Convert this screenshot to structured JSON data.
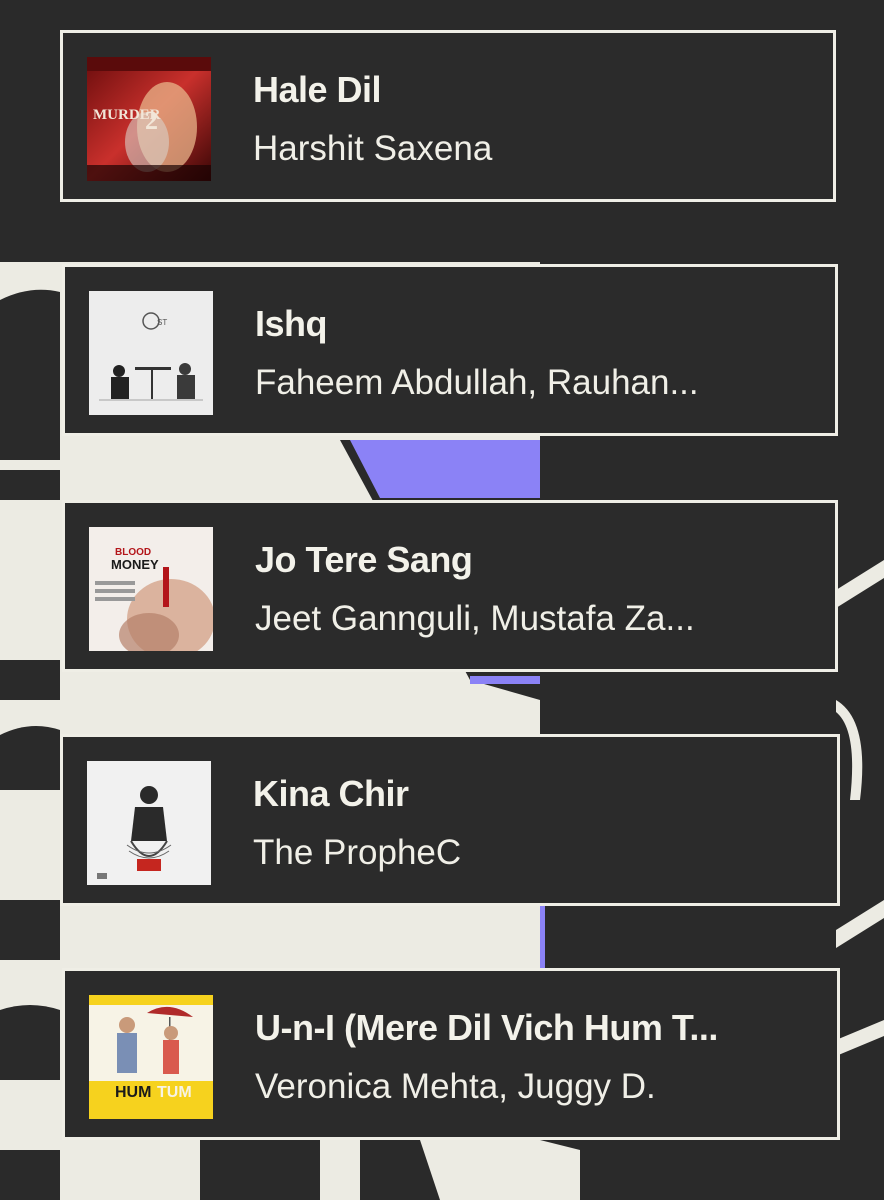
{
  "theme": {
    "background": "#2a2a2a",
    "card_border": "#efeee6",
    "text": "#f3f2ea",
    "accent": "#8b82f6"
  },
  "tracks": [
    {
      "title": "Hale Dil",
      "artist": "Harshit Saxena",
      "art": "murder-2-cover",
      "art_text": "MURDER 2"
    },
    {
      "title": "Ishq",
      "artist": "Faheem Abdullah, Rauhan...",
      "art": "ishq-cover"
    },
    {
      "title": "Jo Tere Sang",
      "artist": "Jeet Gannguli, Mustafa Za...",
      "art": "blood-money-cover",
      "art_text": "BLOOD MONEY"
    },
    {
      "title": "Kina Chir",
      "artist": "The PropheC",
      "art": "kina-chir-cover"
    },
    {
      "title": "U-n-I (Mere Dil Vich Hum T...",
      "artist": "Veronica Mehta, Juggy D.",
      "art": "hum-tum-cover",
      "art_text": "HUM TUM"
    }
  ]
}
